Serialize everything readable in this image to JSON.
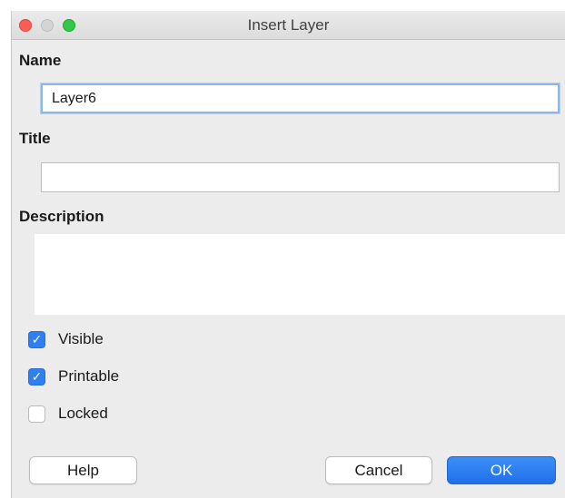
{
  "window": {
    "title": "Insert Layer"
  },
  "form": {
    "name_label": "Name",
    "name_value": "Layer6",
    "title_label": "Title",
    "title_value": "",
    "description_label": "Description",
    "description_value": ""
  },
  "options": [
    {
      "label": "Visible",
      "checked": true
    },
    {
      "label": "Printable",
      "checked": true
    },
    {
      "label": "Locked",
      "checked": false
    }
  ],
  "buttons": {
    "help": "Help",
    "cancel": "Cancel",
    "ok": "OK"
  },
  "colors": {
    "accent": "#2f7ff1",
    "close": "#fd5f57",
    "maximize": "#34c84a"
  }
}
